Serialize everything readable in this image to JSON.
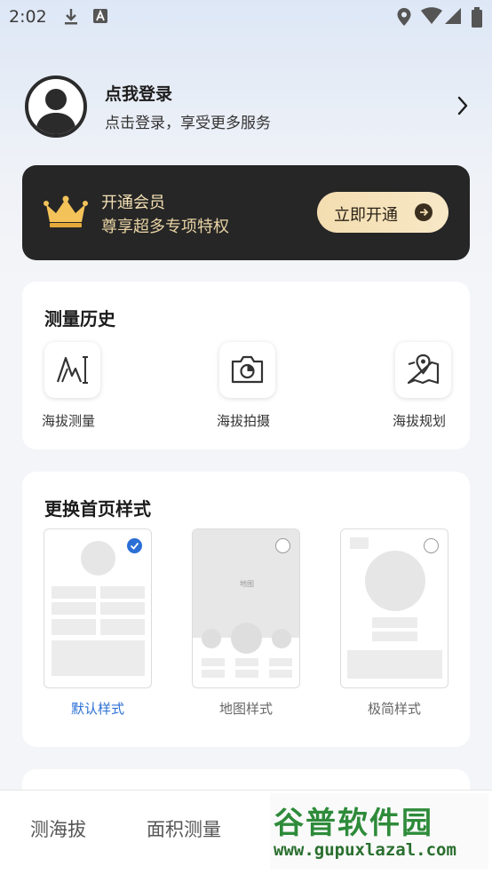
{
  "status_bar": {
    "time": "2:02"
  },
  "profile": {
    "title": "点我登录",
    "subtitle": "点击登录，享受更多服务"
  },
  "vip": {
    "title": "开通会员",
    "subtitle": "尊享超多专项特权",
    "button_label": "立即开通"
  },
  "history": {
    "title": "测量历史",
    "items": [
      {
        "label": "海拔测量",
        "icon": "altitude-measure-icon"
      },
      {
        "label": "海拔拍摄",
        "icon": "camera-icon"
      },
      {
        "label": "海拔规划",
        "icon": "map-pin-icon"
      }
    ]
  },
  "home_style": {
    "title": "更换首页样式",
    "options": [
      {
        "label": "默认样式",
        "selected": true
      },
      {
        "label": "地图样式",
        "selected": false,
        "thumb_text": "地图"
      },
      {
        "label": "极简样式",
        "selected": false
      }
    ]
  },
  "bottom_nav": {
    "tabs": [
      "测海拔",
      "面积测量"
    ]
  },
  "watermark": {
    "title": "谷普软件园",
    "url": "www.gupuxlazal.com"
  },
  "colors": {
    "accent": "#2b6fd6",
    "vip_bg": "#262626",
    "vip_gold": "#f3ddb0",
    "watermark_green": "#2e8b3a"
  }
}
